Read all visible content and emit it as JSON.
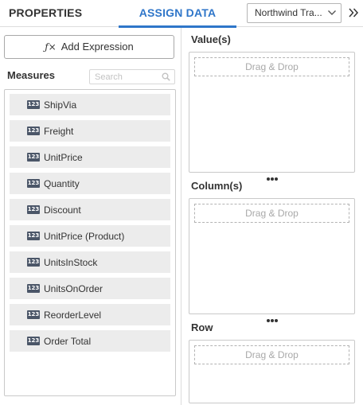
{
  "tabs": {
    "properties": "PROPERTIES",
    "assign_data": "ASSIGN DATA"
  },
  "datasource": {
    "selected": "Northwind Tra..."
  },
  "left": {
    "add_expression_icon": "ƒ×",
    "add_expression_label": "Add Expression",
    "measures_title": "Measures",
    "search_placeholder": "Search",
    "type_badge": "123",
    "measures": [
      "ShipVia",
      "Freight",
      "UnitPrice",
      "Quantity",
      "Discount",
      "UnitPrice (Product)",
      "UnitsInStock",
      "UnitsOnOrder",
      "ReorderLevel",
      "Order Total"
    ]
  },
  "right": {
    "values_title": "Value(s)",
    "columns_title": "Column(s)",
    "row_title": "Row",
    "drop_hint": "Drag & Drop"
  },
  "colors": {
    "accent": "#2f76c9",
    "item_bg": "#ececec",
    "badge_bg": "#4b5668"
  },
  "icons": {
    "datasource_dropdown": "chevron-down-icon",
    "collapse": "double-chevron-right-icon",
    "search": "search-icon",
    "resize": "ellipsis-icon"
  }
}
